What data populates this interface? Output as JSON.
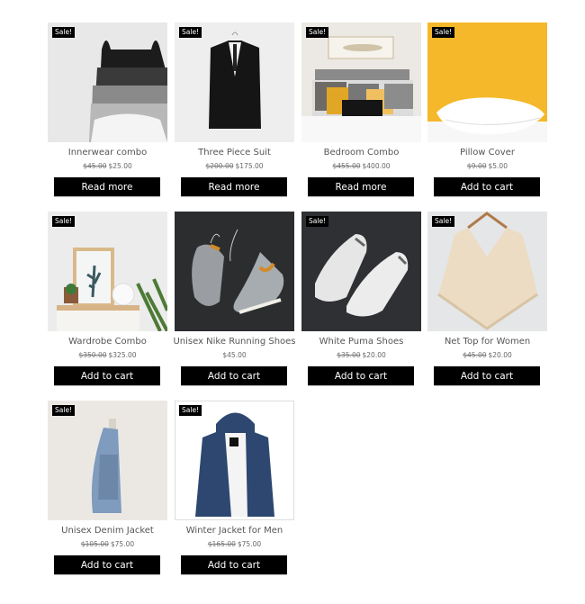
{
  "products": [
    {
      "name": "Innerwear combo",
      "regular_price": "$45.00",
      "sale_price": "$25.00",
      "button": "Read more",
      "badge": "Sale!",
      "image": "tank-tops-image"
    },
    {
      "name": "Three Piece Suit",
      "regular_price": "$200.00",
      "sale_price": "$175.00",
      "button": "Read more",
      "badge": "Sale!",
      "image": "suit-image"
    },
    {
      "name": "Bedroom Combo",
      "regular_price": "$455.00",
      "sale_price": "$400.00",
      "button": "Read more",
      "badge": "Sale!",
      "image": "bedroom-image"
    },
    {
      "name": "Pillow Cover",
      "regular_price": "$9.00",
      "sale_price": "$5.00",
      "button": "Add to cart",
      "badge": "Sale!",
      "image": "pillow-image"
    },
    {
      "name": "Wardrobe Combo",
      "regular_price": "$350.00",
      "sale_price": "$325.00",
      "button": "Add to cart",
      "badge": "Sale!",
      "image": "wardrobe-image"
    },
    {
      "name": "Unisex Nike Running Shoes",
      "regular_price": "",
      "sale_price": "$45.00",
      "button": "Add to cart",
      "badge": "",
      "image": "nike-shoes-image"
    },
    {
      "name": "White Puma Shoes",
      "regular_price": "$35.00",
      "sale_price": "$20.00",
      "button": "Add to cart",
      "badge": "Sale!",
      "image": "puma-shoes-image"
    },
    {
      "name": "Net Top for Women",
      "regular_price": "$45.00",
      "sale_price": "$20.00",
      "button": "Add to cart",
      "badge": "Sale!",
      "image": "net-top-image"
    },
    {
      "name": "Unisex Denim Jacket",
      "regular_price": "$105.00",
      "sale_price": "$75.00",
      "button": "Add to cart",
      "badge": "Sale!",
      "image": "denim-jacket-image"
    },
    {
      "name": "Winter Jacket for Men",
      "regular_price": "$165.00",
      "sale_price": "$75.00",
      "button": "Add to cart",
      "badge": "Sale!",
      "image": "winter-jacket-image"
    }
  ]
}
